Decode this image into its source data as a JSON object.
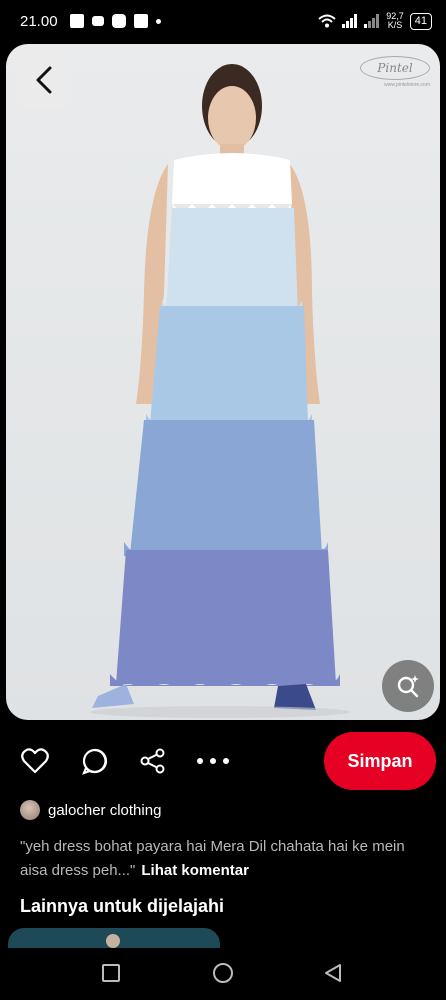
{
  "status_bar": {
    "time": "21.00",
    "speed_value": "92,7",
    "speed_unit": "K/S",
    "battery": "41"
  },
  "pin": {
    "watermark": "Pintel",
    "watermark_url": "www.pintelstore.com",
    "image_subject": "woman in tiered scalloped pastel blue maxi dress"
  },
  "actions": {
    "like_icon": "heart-icon",
    "comment_icon": "comment-icon",
    "share_icon": "share-icon",
    "more_icon": "more-icon",
    "save_label": "Simpan",
    "accent": "#e60023"
  },
  "creator": {
    "name": "galocher clothing"
  },
  "comment": {
    "text": "\"yeh dress bohat payara hai Mera Dil chahata hai ke mein aisa dress peh...\"",
    "link": "Lihat komentar"
  },
  "explore": {
    "title": "Lainnya untuk dijelajahi"
  },
  "navbar": {
    "recent_icon": "square-icon",
    "home_icon": "circle-icon",
    "back_icon": "triangle-back-icon"
  }
}
